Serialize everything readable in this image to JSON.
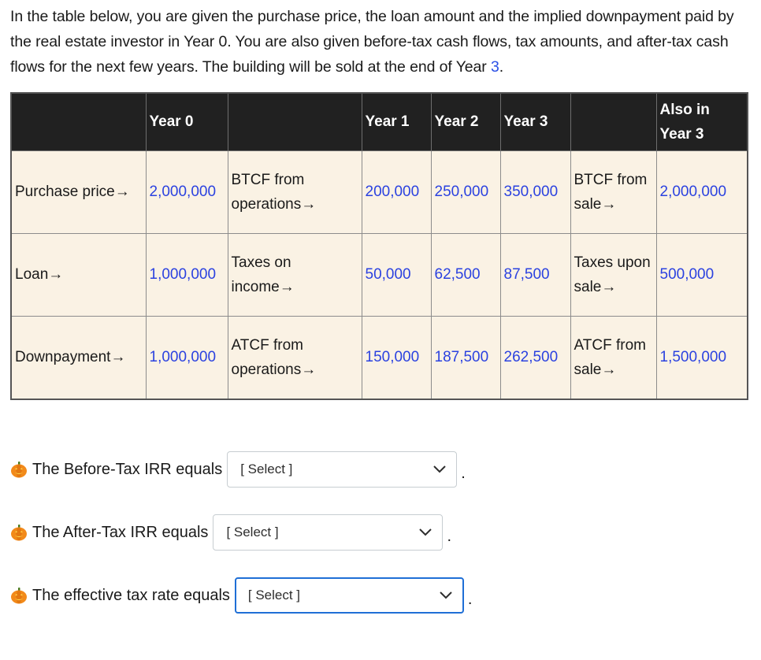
{
  "intro": {
    "text_before_link": "In the table below, you are given the purchase price, the loan amount and the implied downpayment paid by the real estate investor in Year 0. You are also given before-tax cash flows, tax amounts, and after-tax cash flows for the next few years. The building will be sold at the end of Year ",
    "link_text": "3",
    "text_after_link": "."
  },
  "table": {
    "headers": [
      "",
      "Year 0",
      "",
      "Year 1",
      "Year 2",
      "Year 3",
      "",
      "Also in Year 3"
    ],
    "rows": [
      {
        "label": "Purchase price→",
        "year0": "2,000,000",
        "ops_label": "BTCF from operations→",
        "year1": "200,000",
        "year2": "250,000",
        "year3": "350,000",
        "sale_label": "BTCF from sale→",
        "sale_value": "2,000,000"
      },
      {
        "label": "Loan→",
        "year0": "1,000,000",
        "ops_label": "Taxes on income→",
        "year1": "50,000",
        "year2": "62,500",
        "year3": "87,500",
        "sale_label": "Taxes upon sale→",
        "sale_value": "500,000"
      },
      {
        "label": "Downpayment→",
        "year0": "1,000,000",
        "ops_label": "ATCF from operations→",
        "year1": "150,000",
        "year2": "187,500",
        "year3": "262,500",
        "sale_label": "ATCF from sale→",
        "sale_value": "1,500,000"
      }
    ]
  },
  "questions": [
    {
      "icon": "pumpkin-icon",
      "prompt": "The Before-Tax IRR equals",
      "selected": "[ Select ]",
      "suffix": "."
    },
    {
      "icon": "pumpkin-icon",
      "prompt": "The After-Tax IRR equals",
      "selected": "[ Select ]",
      "suffix": "."
    },
    {
      "icon": "pumpkin-icon",
      "prompt": "The effective tax rate equals",
      "selected": "[ Select ]",
      "suffix": "."
    }
  ],
  "colors": {
    "number_blue": "#2b42e0",
    "header_bg": "#212121",
    "cell_bg": "#faf2e4",
    "focus_border": "#1f6fd6"
  }
}
